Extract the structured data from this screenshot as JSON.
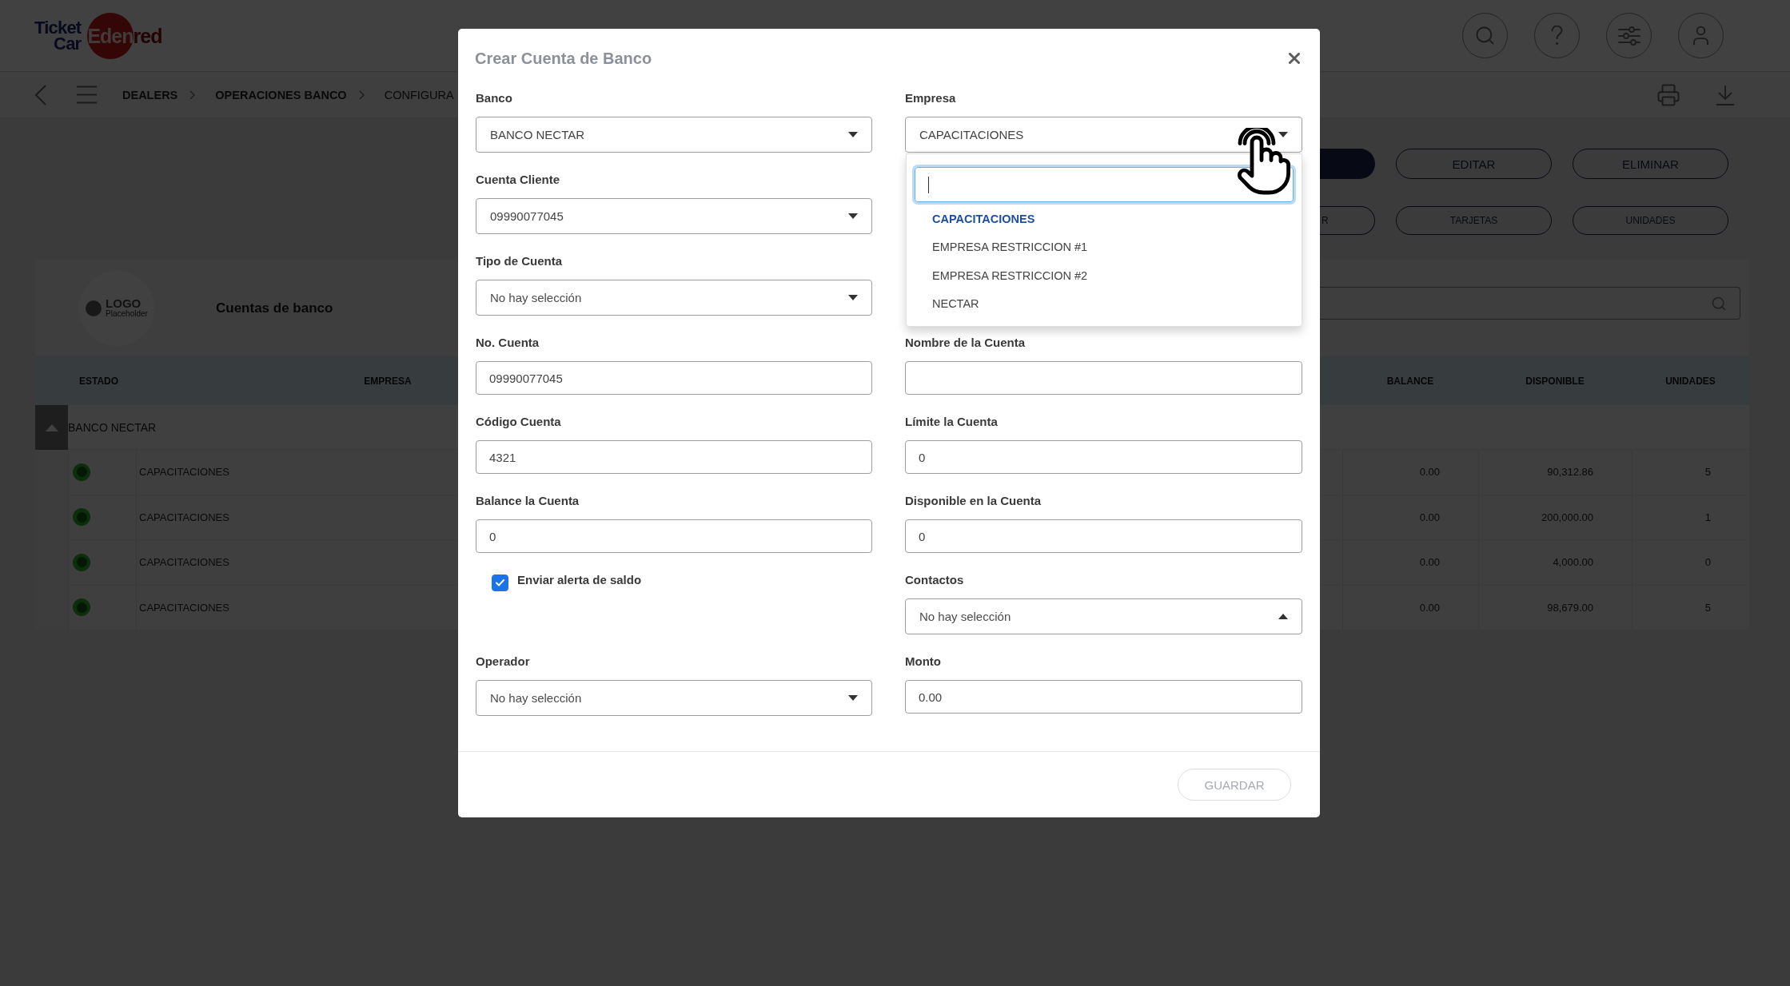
{
  "header": {
    "logo": {
      "line_1": "Ticket",
      "line_2": "Car",
      "brand": "Edenred"
    }
  },
  "breadcrumb": [
    {
      "label": "DEALERS",
      "current": false
    },
    {
      "label": "OPERACIONES BANCO",
      "current": false
    },
    {
      "label": "CONFIGURA",
      "current": true
    }
  ],
  "action_buttons": [
    {
      "kind": "primary"
    },
    {
      "kind": "outline",
      "label": "EDITAR"
    },
    {
      "kind": "outline",
      "label": "ELIMINAR"
    }
  ],
  "view_buttons": [
    {
      "label": "R"
    },
    {
      "label": "TARJETAS"
    },
    {
      "label": "UNIDADES"
    }
  ],
  "card": {
    "logo_placeholder": {
      "title": "LOGO",
      "subtitle": "Placeholder"
    },
    "title": "Cuentas de banco"
  },
  "table": {
    "columns": [
      "ESTADO",
      "EMPRESA",
      "BALANCE",
      "DISPONIBLE",
      "UNIDADES"
    ],
    "groups": [
      {
        "label": "BANCO NECTAR",
        "expanded": true,
        "rows": [
          {
            "active": true,
            "empresa": "CAPACITACIONES",
            "balance": "0.00",
            "disponible": "90,312.86",
            "unidades": "5"
          },
          {
            "active": true,
            "empresa": "CAPACITACIONES",
            "balance": "0.00",
            "disponible": "200,000.00",
            "unidades": "1"
          },
          {
            "active": true,
            "empresa": "CAPACITACIONES",
            "balance": "0.00",
            "disponible": "4,000.00",
            "unidades": "0"
          },
          {
            "active": true,
            "empresa": "CAPACITACIONES",
            "balance": "0.00",
            "disponible": "98,679.00",
            "unidades": "5"
          }
        ]
      }
    ]
  },
  "modal": {
    "title": "Crear Cuenta de Banco",
    "rows": [
      [
        {
          "kind": "select",
          "label": "Banco",
          "value": "BANCO NECTAR",
          "dropup": false
        },
        {
          "kind": "select",
          "label": "Empresa",
          "value": "CAPACITACIONES",
          "dropup": false,
          "search_focused": true,
          "options": [
            {
              "label": "CAPACITACIONES",
              "selected": true
            },
            {
              "label": "EMPRESA RESTRICCION #1",
              "selected": false
            },
            {
              "label": "EMPRESA RESTRICCION #2",
              "selected": false
            },
            {
              "label": "NECTAR",
              "selected": false
            }
          ]
        }
      ],
      [
        {
          "kind": "select",
          "label": "Cuenta Cliente",
          "value": "09990077045",
          "dropup": false
        }
      ],
      [
        {
          "kind": "select",
          "label": "Tipo de Cuenta",
          "placeholder": "No hay selección",
          "dropup": false
        }
      ],
      [
        {
          "kind": "text",
          "label": "No. Cuenta",
          "value": "09990077045"
        },
        {
          "kind": "text",
          "label": "Nombre de la Cuenta"
        }
      ],
      [
        {
          "kind": "text",
          "label": "Código Cuenta",
          "value": "4321"
        },
        {
          "kind": "text",
          "label": "Límite la Cuenta",
          "value": "0"
        }
      ],
      [
        {
          "kind": "text",
          "label": "Balance la Cuenta",
          "value": "0"
        },
        {
          "kind": "text",
          "label": "Disponible en la Cuenta",
          "value": "0"
        }
      ],
      [
        {
          "kind": "checkbox",
          "label": "Enviar alerta de saldo",
          "checked": true
        },
        {
          "kind": "select",
          "label": "Contactos",
          "placeholder": "No hay selección",
          "dropup": true
        }
      ],
      [
        {
          "kind": "select",
          "label": "Operador",
          "placeholder": "No hay selección",
          "dropup": false
        },
        {
          "kind": "text",
          "label": "Monto",
          "value": "0.00"
        }
      ]
    ],
    "buttons": [
      {
        "label": "GUARDAR",
        "disabled": true
      }
    ]
  }
}
